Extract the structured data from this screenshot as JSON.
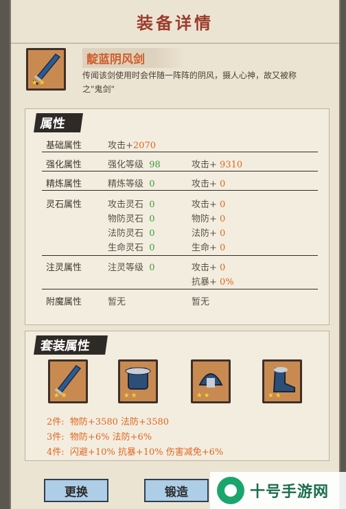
{
  "title": "装备详情",
  "item": {
    "name": "靛蓝阴风剑",
    "stars": "★★",
    "description": "传闻该剑使用时会伴随一阵阵的阴风，摄人心神，故又被称之\"鬼剑\""
  },
  "attributes": {
    "section_title": "属性",
    "base": {
      "label": "基础属性",
      "stat": "攻击+",
      "value": "2070"
    },
    "enhance": {
      "label": "强化属性",
      "level_label": "强化等级",
      "level": "98",
      "stat": "攻击+",
      "value": "9310"
    },
    "refine": {
      "label": "精炼属性",
      "level_label": "精炼等级",
      "level": "0",
      "stat": "攻击+",
      "value": "0"
    },
    "spirit_stone": {
      "label": "灵石属性",
      "rows": [
        {
          "name": "攻击灵石",
          "count": "0",
          "stat": "攻击+",
          "value": "0"
        },
        {
          "name": "物防灵石",
          "count": "0",
          "stat": "物防+",
          "value": "0"
        },
        {
          "name": "法防灵石",
          "count": "0",
          "stat": "法防+",
          "value": "0"
        },
        {
          "name": "生命灵石",
          "count": "0",
          "stat": "生命+",
          "value": "0"
        }
      ]
    },
    "infuse": {
      "label": "注灵属性",
      "level_label": "注灵等级",
      "level": "0",
      "stat1": "攻击+",
      "value1": "0",
      "stat2": "抗暴+",
      "value2": "0%"
    },
    "enchant": {
      "label": "附魔属性",
      "left": "暂无",
      "right": "暂无"
    }
  },
  "set": {
    "section_title": "套装属性",
    "icons": [
      "sword-icon",
      "armor-icon",
      "helmet-icon",
      "boots-icon"
    ],
    "stars": "★★",
    "bonuses": [
      {
        "pieces": "2件:",
        "text": "物防+3580  法防+3580"
      },
      {
        "pieces": "3件:",
        "text": "物防+6%  法防+6%"
      },
      {
        "pieces": "4件:",
        "text": "闪避+10%  抗暴+10%  伤害减免+6%"
      }
    ]
  },
  "buttons": {
    "replace": "更换",
    "forge": "锻造"
  },
  "watermark": "十号手游网",
  "colors": {
    "accent": "#e0661f",
    "green": "#3c9a37",
    "title": "#9b3b2c"
  }
}
